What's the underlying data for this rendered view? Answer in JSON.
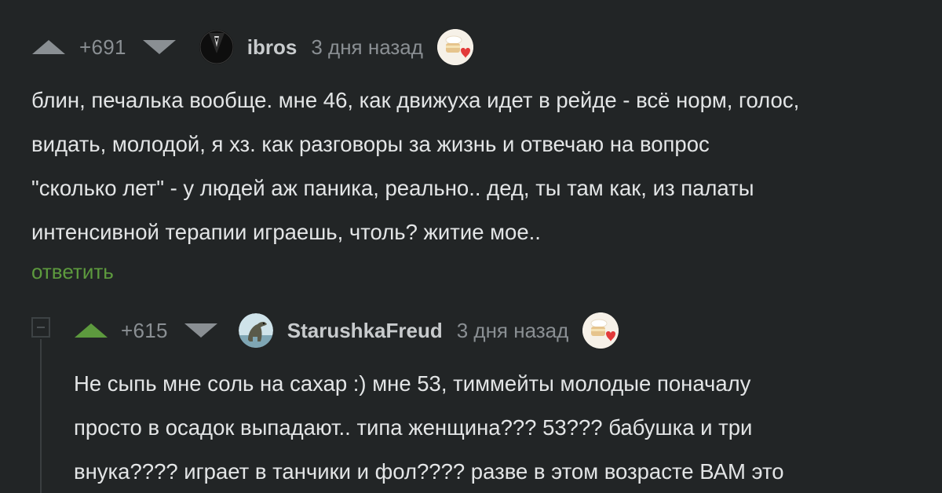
{
  "colors": {
    "background": "#222526",
    "text": "#e3e5e6",
    "muted": "#8a8f93",
    "accent_green": "#5d9a3e",
    "vote_active": "#5d9a3e",
    "vote_inactive": "#8a8f93"
  },
  "comments": [
    {
      "rating": "+691",
      "username": "ibros",
      "time": "3 дня назад",
      "avatar_icon": "tuxedo-avatar",
      "badge_icon": "cake-heart-badge",
      "upvote_active": false,
      "text": "блин, печалька вообще. мне 46, как движуха идет в рейде - всё норм, голос,\nвидать, молодой, я хз. как разговоры за жизнь и отвечаю на вопрос\n\"сколько лет\" - у людей аж паника, реально.. дед, ты там как, из палаты\nинтенсивной терапии играешь, чтоль? житие мое..",
      "reply_label": "ответить"
    },
    {
      "rating": "+615",
      "username": "StarushkaFreud",
      "time": "3 дня назад",
      "avatar_icon": "dinosaur-avatar",
      "badge_icon": "cake-heart-badge",
      "upvote_active": true,
      "text": "Не сыпь мне соль на сахар :) мне 53, тиммейты молодые поначалу\nпросто в осадок выпадают.. типа женщина??? 53??? бабушка и три\nвнука???? играет в танчики и фол???? разве в этом возрасте ВАМ это"
    }
  ]
}
